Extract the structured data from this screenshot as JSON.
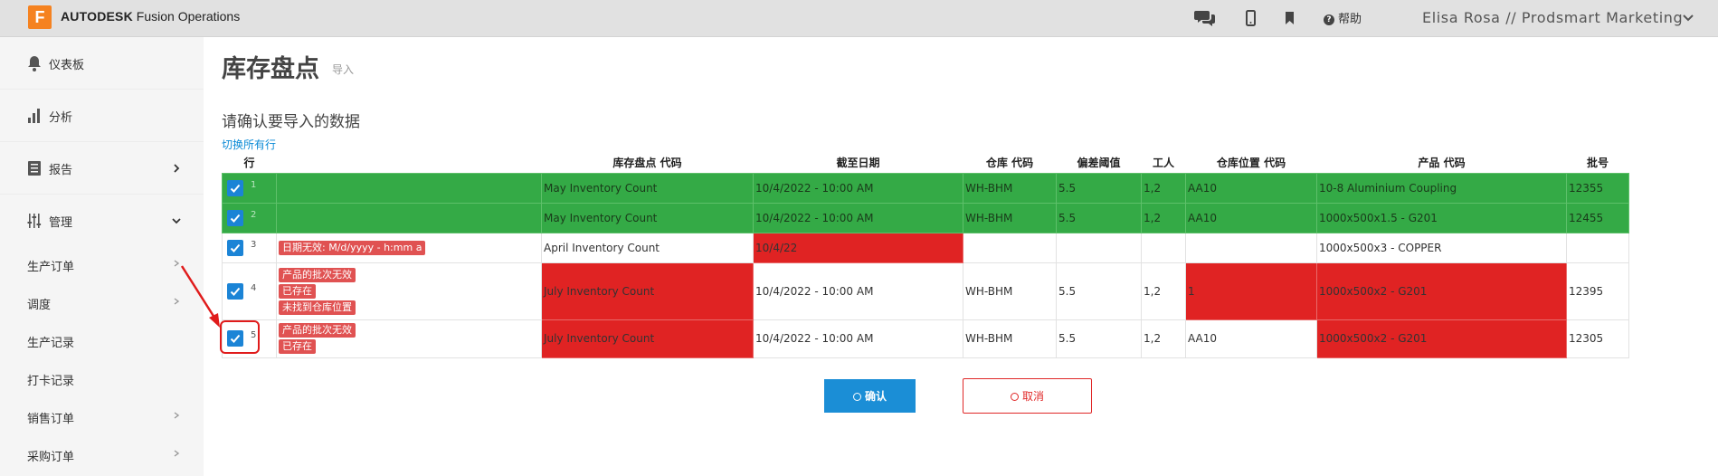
{
  "header": {
    "logo_letter": "F",
    "brand_strong": "AUTODESK",
    "brand_rest": "Fusion Operations",
    "help_label": "帮助",
    "user_label": "Elisa Rosa // Prodsmart Marketing"
  },
  "sidebar": {
    "items": [
      {
        "label": "仪表板"
      },
      {
        "label": "分析"
      },
      {
        "label": "报告"
      },
      {
        "label": "管理"
      }
    ],
    "sub_items": [
      {
        "label": "生产订单"
      },
      {
        "label": "调度"
      },
      {
        "label": "生产记录"
      },
      {
        "label": "打卡记录"
      },
      {
        "label": "销售订单"
      },
      {
        "label": "采购订单"
      }
    ]
  },
  "main": {
    "title": "库存盘点",
    "subtitle": "导入",
    "confirm_title": "请确认要导入的数据",
    "toggle_label": "切换所有行",
    "columns": [
      "行",
      "",
      "库存盘点 代码",
      "截至日期",
      "仓库 代码",
      "偏差阈值",
      "工人",
      "仓库位置 代码",
      "产品 代码",
      "批号"
    ],
    "rows": [
      {
        "num": "1",
        "errors": [],
        "count": "May Inventory Count",
        "date": "10/4/2022 - 10:00 AM",
        "wh": "WH-BHM",
        "thr": "5.5",
        "workers": "1,2",
        "loc": "AA10",
        "product": "10-8 Aluminium Coupling",
        "batch": "12355"
      },
      {
        "num": "2",
        "errors": [],
        "count": "May Inventory Count",
        "date": "10/4/2022 - 10:00 AM",
        "wh": "WH-BHM",
        "thr": "5.5",
        "workers": "1,2",
        "loc": "AA10",
        "product": "1000x500x1.5 - G201",
        "batch": "12455"
      },
      {
        "num": "3",
        "errors": [
          "日期无效: M/d/yyyy - h:mm a"
        ],
        "count": "April Inventory Count",
        "date": "10/4/22",
        "wh": "",
        "thr": "",
        "workers": "",
        "loc": "",
        "product": "1000x500x3 - COPPER",
        "batch": ""
      },
      {
        "num": "4",
        "errors": [
          "产品的批次无效",
          "已存在",
          "未找到仓库位置"
        ],
        "count": "July Inventory Count",
        "date": "10/4/2022 - 10:00 AM",
        "wh": "WH-BHM",
        "thr": "5.5",
        "workers": "1,2",
        "loc": "1",
        "product": "1000x500x2 - G201",
        "batch": "12395"
      },
      {
        "num": "5",
        "errors": [
          "产品的批次无效",
          "已存在"
        ],
        "count": "July Inventory Count",
        "date": "10/4/2022 - 10:00 AM",
        "wh": "WH-BHM",
        "thr": "5.5",
        "workers": "1,2",
        "loc": "AA10",
        "product": "1000x500x2 - G201",
        "batch": "12305"
      }
    ],
    "confirm_label": "确认",
    "cancel_label": "取消"
  }
}
